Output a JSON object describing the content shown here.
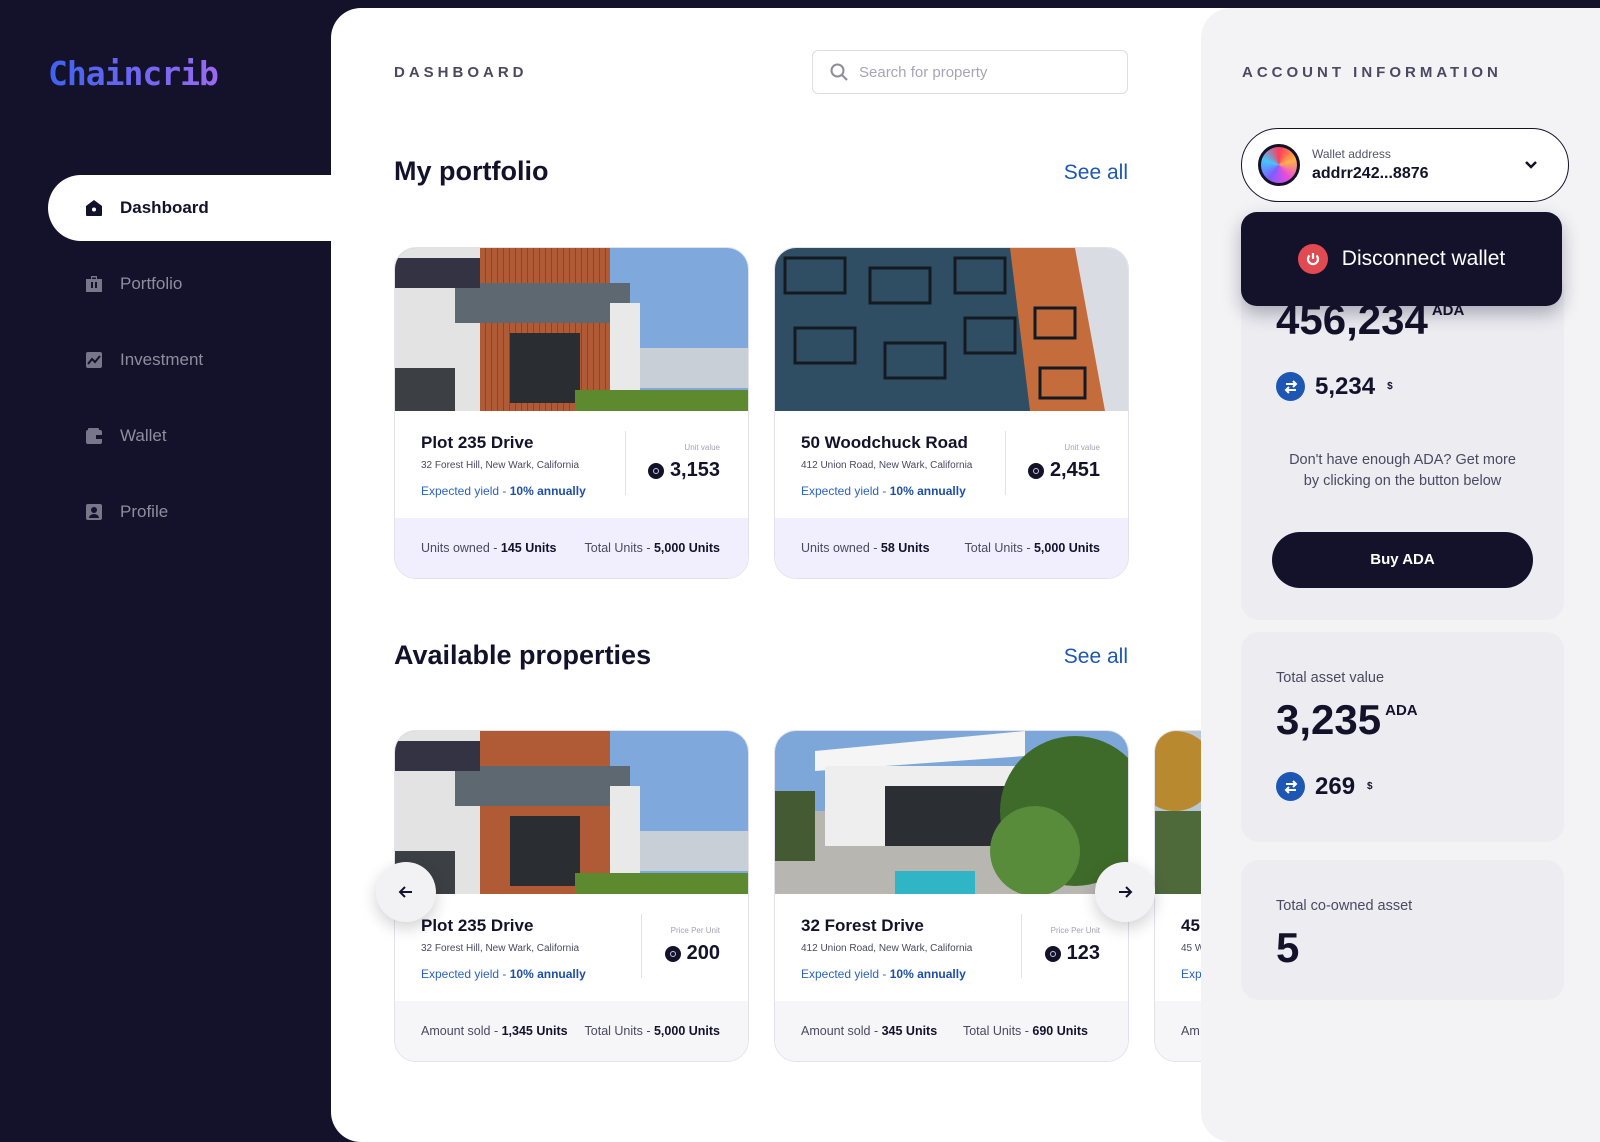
{
  "brand": {
    "name": "Chaincrib"
  },
  "nav": [
    {
      "label": "Dashboard",
      "icon": "home-icon",
      "active": true
    },
    {
      "label": "Portfolio",
      "icon": "briefcase-icon"
    },
    {
      "label": "Investment",
      "icon": "chart-icon"
    },
    {
      "label": "Wallet",
      "icon": "wallet-icon"
    },
    {
      "label": "Profile",
      "icon": "profile-icon"
    }
  ],
  "header": {
    "title": "DASHBOARD",
    "search_placeholder": "Search for property"
  },
  "portfolio": {
    "title": "My portfolio",
    "see_all": "See all",
    "cards": [
      {
        "name": "Plot 235 Drive",
        "address": "32 Forest Hill, New Wark, California",
        "yield_label": "Expected yield - ",
        "yield_value": "10% annually",
        "value_label": "Unit value",
        "value": "3,153",
        "units_label": "Units owned - ",
        "units": "145 Units",
        "total_label": "Total Units - ",
        "total": "5,000 Units"
      },
      {
        "name": "50 Woodchuck Road",
        "address": "412 Union Road, New Wark, California",
        "yield_label": "Expected yield - ",
        "yield_value": "10% annually",
        "value_label": "Unit value",
        "value": "2,451",
        "units_label": "Units owned - ",
        "units": "58 Units",
        "total_label": "Total Units - ",
        "total": "5,000 Units"
      }
    ]
  },
  "available": {
    "title": "Available properties",
    "see_all": "See all",
    "cards": [
      {
        "name": "Plot 235 Drive",
        "address": "32 Forest Hill, New Wark, California",
        "yield_label": "Expected yield - ",
        "yield_value": "10% annually",
        "value_label": "Price Per Unit",
        "value": "200",
        "units_label": "Amount sold - ",
        "units": "1,345 Units",
        "total_label": "Total Units - ",
        "total": "5,000 Units"
      },
      {
        "name": "32 Forest Drive",
        "address": "412 Union Road, New Wark, California",
        "yield_label": "Expected yield - ",
        "yield_value": "10% annually",
        "value_label": "Price Per Unit",
        "value": "123",
        "units_label": "Amount sold - ",
        "units": "345 Units",
        "total_label": "Total Units - ",
        "total": "690 Units"
      },
      {
        "name": "45",
        "address": "45 W",
        "yield_label": "Exp",
        "units_label": "Am"
      }
    ]
  },
  "account": {
    "title": "ACCOUNT INFORMATION",
    "wallet_label": "Wallet address",
    "wallet_address": "addrr242...8876",
    "disconnect": "Disconnect wallet",
    "balance": "456,234",
    "balance_unit": "ADA",
    "balance_usd": "5,234",
    "usd_symbol": "$",
    "note": "Don't have enough ADA? Get more by clicking on the button below",
    "buy": "Buy ADA",
    "asset_label": "Total asset value",
    "asset_value": "3,235",
    "asset_unit": "ADA",
    "asset_usd": "269",
    "coowned_label": "Total co-owned asset",
    "coowned_value": "5"
  },
  "colors": {
    "sidebar": "#14122b",
    "accent": "#1e57b3",
    "disconnect": "#e24a52"
  }
}
